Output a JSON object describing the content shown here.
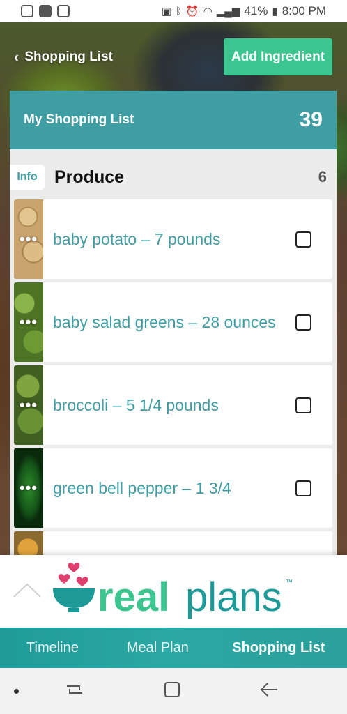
{
  "status_bar": {
    "battery": "41%",
    "time": "8:00 PM",
    "icons": [
      "instagram-icon",
      "facebook-icon",
      "checklist-icon",
      "battery-saver-icon",
      "bluetooth-icon",
      "alarm-icon",
      "wifi-icon",
      "signal-icon",
      "battery-icon"
    ]
  },
  "header": {
    "back_label": "Shopping List",
    "add_button_label": "Add Ingredient"
  },
  "list": {
    "title": "My Shopping List",
    "count": "39"
  },
  "section": {
    "info_label": "Info",
    "title": "Produce",
    "count": "6",
    "items": [
      {
        "label": "baby potato – 7 pounds",
        "checked": false,
        "thumb": "potato"
      },
      {
        "label": "baby salad greens – 28 ounces",
        "checked": false,
        "thumb": "greens"
      },
      {
        "label": "broccoli – 5 1/4 pounds",
        "checked": false,
        "thumb": "broccoli"
      },
      {
        "label": "green bell pepper – 1 3/4",
        "checked": false,
        "thumb": "pepper"
      },
      {
        "label": "",
        "checked": false,
        "thumb": "squash"
      }
    ]
  },
  "logo": {
    "text_bold": "real",
    "text_light": "plans",
    "trademark": "™"
  },
  "tabs": [
    {
      "label": "Timeline",
      "active": false
    },
    {
      "label": "Meal Plan",
      "active": false
    },
    {
      "label": "Shopping List",
      "active": true
    }
  ],
  "colors": {
    "teal": "#3f9da4",
    "green_button": "#3cc58e",
    "heart_pink": "#e0406e"
  }
}
